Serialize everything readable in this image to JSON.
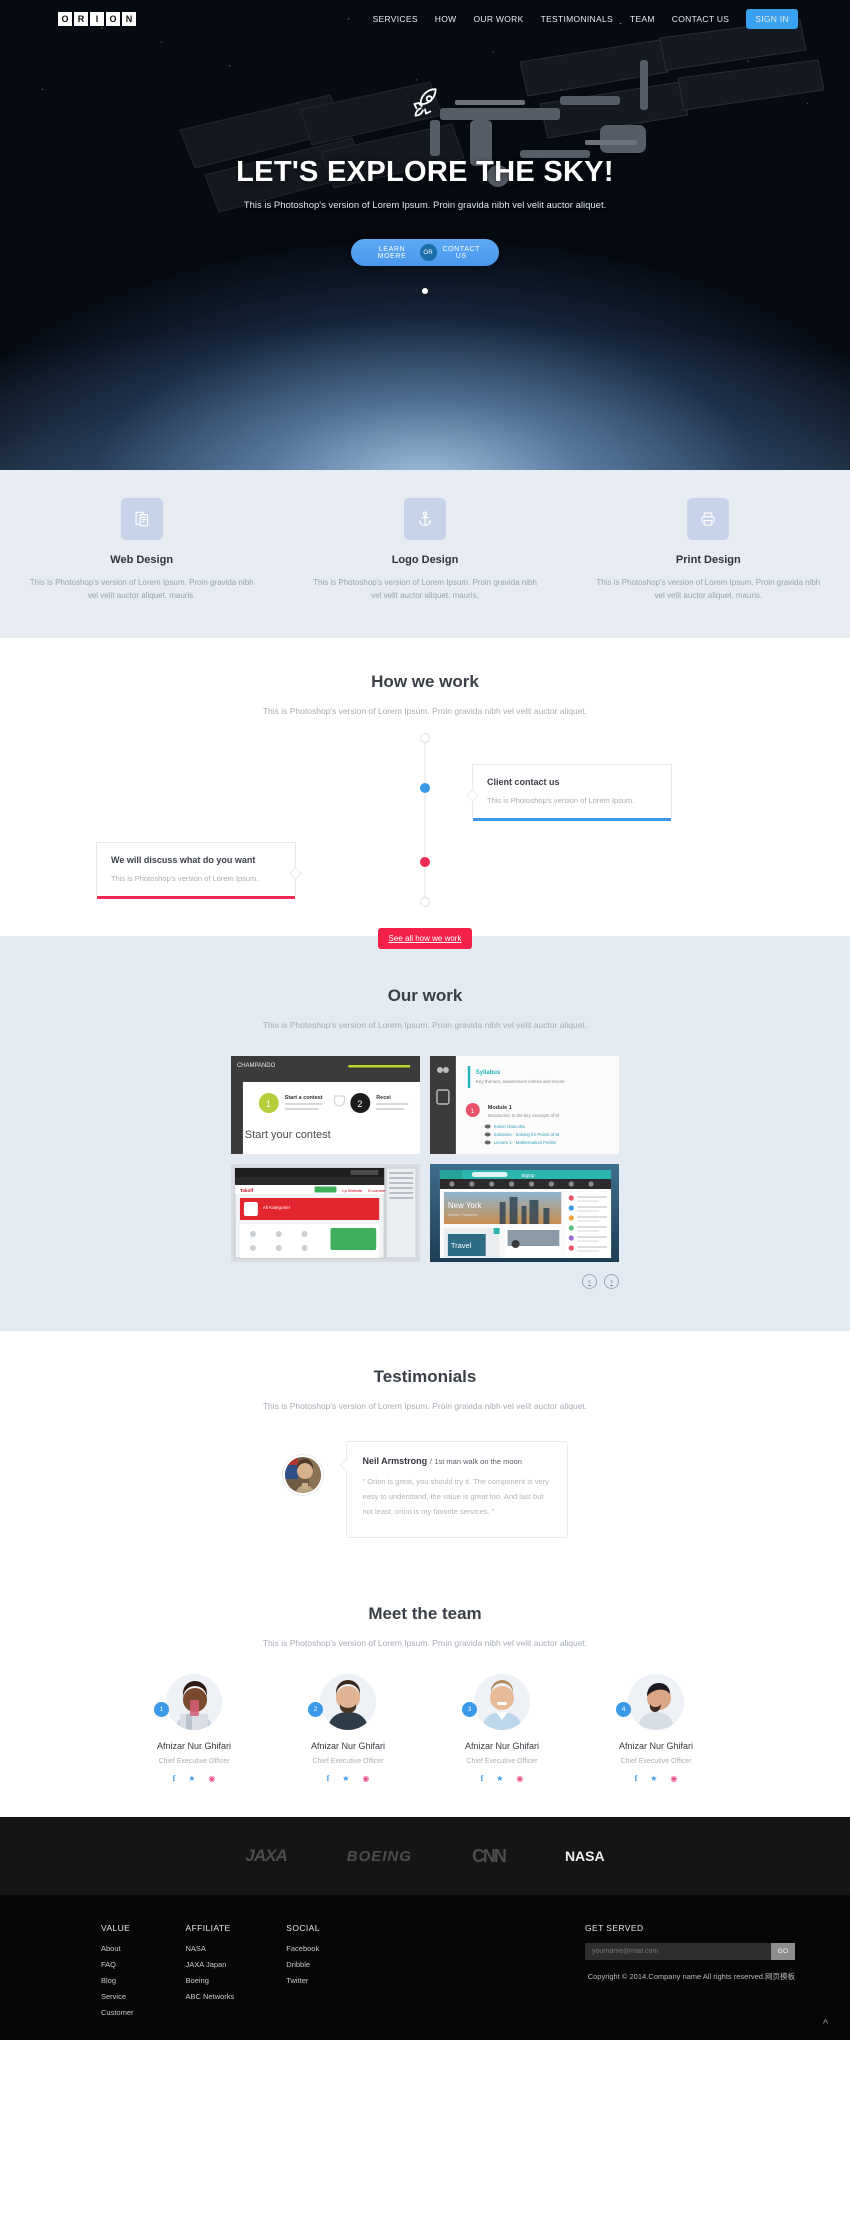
{
  "brand": {
    "letters": [
      "O",
      "R",
      "I",
      "O",
      "N"
    ]
  },
  "nav": {
    "items": [
      "SERVICES",
      "HOW",
      "OUR WORK",
      "TESTIMONINALS",
      "TEAM",
      "CONTACT US"
    ],
    "signin": "SIGN IN"
  },
  "hero": {
    "icon": "rocket-icon",
    "title": "LET'S EXPLORE THE SKY!",
    "subtitle": "This is Photoshop's version of Lorem Ipsum. Proin gravida nibh vel velit auctor aliquet.",
    "primary_cta": "LEARN MOERE",
    "or_label": "OR",
    "secondary_cta": "CONTACT US"
  },
  "services": [
    {
      "icon": "web-design-icon",
      "title": "Web Design",
      "text": "This is Photoshop's version of Lorem Ipsum. Proin gravida nibh vel velit auctor aliquet. mauris."
    },
    {
      "icon": "anchor-icon",
      "title": "Logo Design",
      "text": "This is Photoshop's version of Lorem Ipsum. Proin gravida nibh vel velit auctor aliquet. mauris."
    },
    {
      "icon": "printer-icon",
      "title": "Print Design",
      "text": "This is Photoshop's version of Lorem Ipsum. Proin gravida nibh vel velit auctor aliquet. mauris."
    }
  ],
  "how": {
    "title": "How we work",
    "subtitle": "This is Photoshop's version of Lorem Ipsum. Proin gravida nibh vel velit auctor aliquet.",
    "steps": [
      {
        "title": "Client contact us",
        "text": "This is Photoshop's version of Lorem Ipsum.",
        "accent": "#3a9ae8"
      },
      {
        "title": "We will discuss what do you want",
        "text": "This is Photoshop's version of Lorem Ipsum.",
        "accent": "#ec2a54"
      }
    ],
    "see_all": "See all how we work"
  },
  "work": {
    "title": "Our work",
    "subtitle": "This is Photoshop's version of Lorem Ipsum. Proin gravida nibh vel velit auctor aliquet.",
    "thumbs": [
      {
        "name": "contest-dashboard-thumb",
        "caption": "Start your contest"
      },
      {
        "name": "syllabus-course-thumb",
        "caption": "Syllabus"
      },
      {
        "name": "red-shop-website-thumb",
        "caption": ""
      },
      {
        "name": "travel-app-thumb",
        "caption": "Travel"
      }
    ],
    "prev": "‹",
    "next": "›"
  },
  "testimonials": {
    "title": "Testimonials",
    "subtitle": "This is Photoshop's version of Lorem Ipsum. Proin gravida nibh vel velit auctor aliquet.",
    "item": {
      "name": "Neil Armstrong",
      "separator": "/",
      "role": "1st man walk on the moon",
      "quote": "\" Orion is great, you should try it. The component is very easy to understand, the value is great too. And last but not least, orion is my favorite services. \""
    }
  },
  "team": {
    "title": "Meet the team",
    "subtitle": "This is Photoshop's version of Lorem Ipsum. Proin gravida nibh vel velit auctor aliquet.",
    "members": [
      {
        "badge": "1",
        "name": "Afnizar Nur Ghifari",
        "role": "Chief Executive Officer"
      },
      {
        "badge": "2",
        "name": "Afnizar Nur Ghifari",
        "role": "Chief Executive Officer"
      },
      {
        "badge": "3",
        "name": "Afnizar Nur Ghifari",
        "role": "Chief Executive Officer"
      },
      {
        "badge": "4",
        "name": "Afnizar Nur Ghifari",
        "role": "Chief Executive Officer"
      }
    ],
    "social": [
      "f",
      "twitter",
      "dribbble"
    ]
  },
  "brands": [
    "JAXA",
    "BOEING",
    "CNN",
    "NASA"
  ],
  "footer": {
    "columns": [
      {
        "heading": "VALUE",
        "links": [
          "About",
          "FAQ",
          "Blog",
          "Service",
          "Customer"
        ]
      },
      {
        "heading": "AFFILIATE",
        "links": [
          "NASA",
          "JAXA Japan",
          "Boeing",
          "ABC Networks"
        ]
      },
      {
        "heading": "SOCIAL",
        "links": [
          "Facebook",
          "Dribble",
          "Twitter"
        ]
      }
    ],
    "subscribe": {
      "heading": "GET SERVED",
      "placeholder": "yourname@mail.com",
      "button": "GO"
    },
    "copyright": "Copyright © 2014.Company name All rights reserved.网页模板",
    "to_top": "^"
  },
  "colors": {
    "accent_blue": "#38a1f0",
    "accent_red": "#f5204a",
    "services_bg": "#e7ecf3",
    "work_bg": "#e4eaf2",
    "footer_bg": "#060606"
  }
}
